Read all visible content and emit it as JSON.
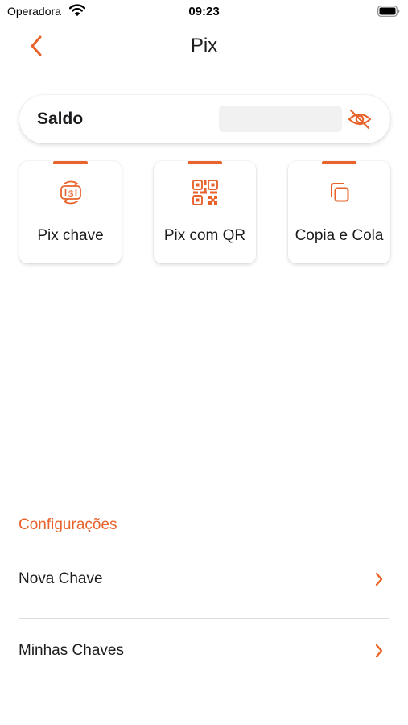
{
  "status_bar": {
    "carrier": "Operadora",
    "time": "09:23"
  },
  "nav": {
    "title": "Pix"
  },
  "balance": {
    "label": "Saldo"
  },
  "actions": [
    {
      "label": "Pix chave",
      "icon": "money-transfer-icon"
    },
    {
      "label": "Pix com QR",
      "icon": "qr-code-icon"
    },
    {
      "label": "Copia e Cola",
      "icon": "copy-icon"
    }
  ],
  "settings": {
    "title": "Configurações",
    "items": [
      {
        "label": "Nova Chave"
      },
      {
        "label": "Minhas Chaves"
      }
    ]
  },
  "colors": {
    "accent": "#e8632b"
  }
}
